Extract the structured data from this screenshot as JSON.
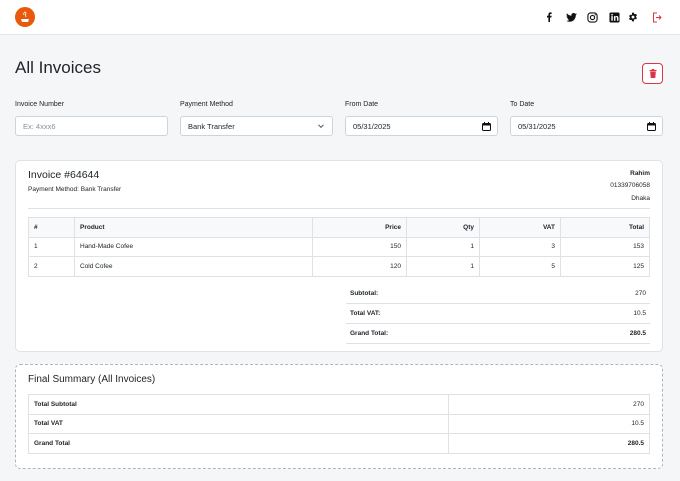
{
  "header": {
    "social": [
      "facebook-icon",
      "twitter-icon",
      "instagram-icon",
      "linkedin-icon",
      "gear-icon",
      "logout-icon"
    ]
  },
  "page": {
    "title": "All Invoices"
  },
  "filters": {
    "invoice_number": {
      "label": "Invoice Number",
      "placeholder": "Ex: 4xxx6"
    },
    "payment_method": {
      "label": "Payment Method",
      "value": "Bank Transfer"
    },
    "from_date": {
      "label": "From Date",
      "value": "05/31/2025"
    },
    "to_date": {
      "label": "To Date",
      "value": "05/31/2025"
    }
  },
  "invoice": {
    "title": "Invoice #64644",
    "payment_method": "Payment Method: Bank Transfer",
    "customer": {
      "name": "Rahim",
      "phone": "01339706058",
      "city": "Dhaka"
    },
    "columns": [
      "#",
      "Product",
      "Price",
      "Qty",
      "VAT",
      "Total"
    ],
    "rows": [
      {
        "no": "1",
        "product": "Hand-Made Cofee",
        "price": "150",
        "qty": "1",
        "vat": "3",
        "total": "153"
      },
      {
        "no": "2",
        "product": "Cold Cofee",
        "price": "120",
        "qty": "1",
        "vat": "5",
        "total": "125"
      }
    ],
    "totals": {
      "subtotal_label": "Subtotal:",
      "subtotal": "270",
      "vat_label": "Total VAT:",
      "vat": "10.5",
      "grand_label": "Grand Total:",
      "grand": "280.5"
    }
  },
  "summary": {
    "title": "Final Summary (All Invoices)",
    "rows": [
      {
        "label": "Total Subtotal",
        "value": "270"
      },
      {
        "label": "Total VAT",
        "value": "10.5"
      },
      {
        "label": "Grand Total",
        "value": "280.5"
      }
    ]
  },
  "colors": {
    "brand": "#e8590c",
    "danger": "#dc3545",
    "background": "#f5f6f8"
  }
}
